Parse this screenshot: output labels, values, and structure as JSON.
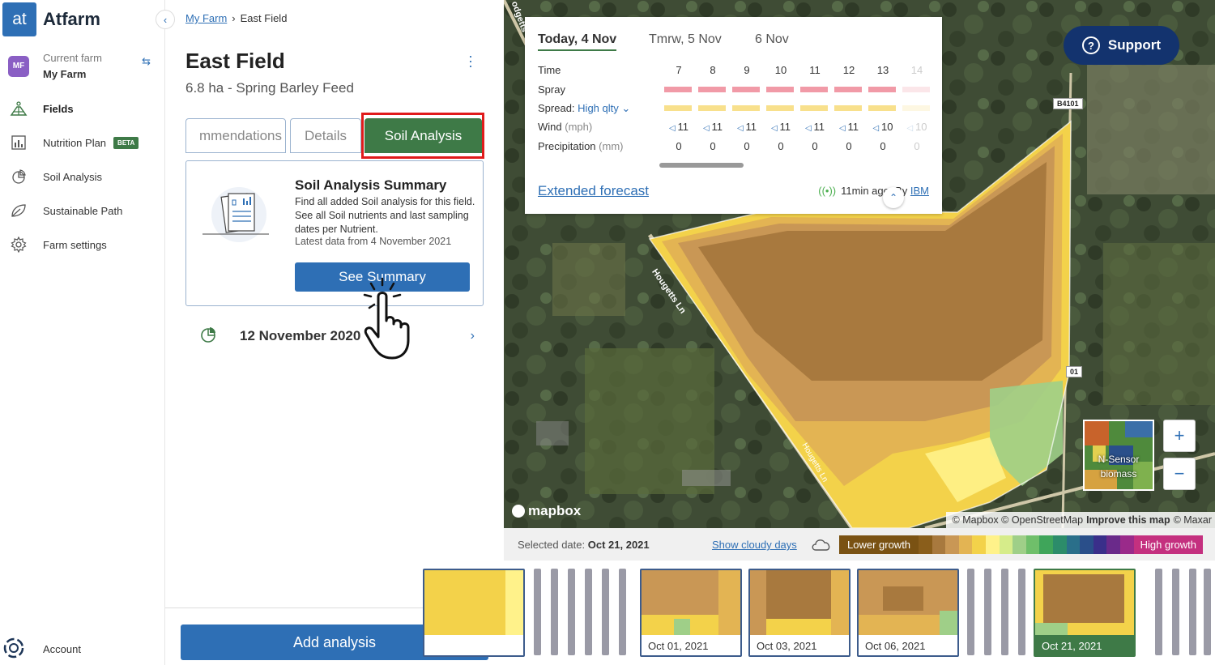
{
  "brand": {
    "logo_mark": "at",
    "name": "Atfarm"
  },
  "farm": {
    "avatar": "MF",
    "caption": "Current farm",
    "name": "My Farm"
  },
  "nav": {
    "fields": "Fields",
    "nutrition_plan": "Nutrition Plan",
    "beta": "BETA",
    "soil_analysis": "Soil Analysis",
    "sustainable_path": "Sustainable Path",
    "farm_settings": "Farm settings",
    "account": "Account"
  },
  "breadcrumb": {
    "parent": "My Farm",
    "separator": "›",
    "current": "East Field"
  },
  "field": {
    "title": "East Field",
    "subtitle": "6.8 ha - Spring Barley Feed"
  },
  "tabs": {
    "recommendations": "mmendations",
    "details": "Details",
    "soil_analysis": "Soil Analysis"
  },
  "summary": {
    "title": "Soil Analysis Summary",
    "description": "Find all added Soil analysis for this field. See all Soil nutrients and last sampling dates per Nutrient.",
    "latest": "Latest data from 4 November 2021",
    "button": "See Summary"
  },
  "analysis_entry": {
    "date": "12 November 2020"
  },
  "add_button": "Add analysis",
  "weather": {
    "tabs": [
      "Today, 4 Nov",
      "Tmrw, 5 Nov",
      "6 Nov"
    ],
    "labels": {
      "time": "Time",
      "spray": "Spray",
      "spread": "Spread:",
      "spread_quality": "High qlty",
      "wind": "Wind",
      "wind_unit": "(mph)",
      "precip": "Precipitation",
      "precip_unit": "(mm)"
    },
    "hours": [
      "7",
      "8",
      "9",
      "10",
      "11",
      "12",
      "13",
      "14"
    ],
    "wind": [
      "11",
      "11",
      "11",
      "11",
      "11",
      "11",
      "10",
      "10"
    ],
    "precip": [
      "0",
      "0",
      "0",
      "0",
      "0",
      "0",
      "0",
      "0"
    ],
    "extended": "Extended forecast",
    "updated": "11min ago. By",
    "provider": "IBM"
  },
  "support": "Support",
  "map": {
    "road_1": "B4101",
    "road_2": "B4101",
    "road_2_visible": "01",
    "lane_1": "Hougetts Ln",
    "lane_2": "Hougetts Ln",
    "left_edge_text": "odgetts",
    "layer_thumb": "N-Sensor biomass",
    "zoom_in": "+",
    "zoom_out": "−",
    "provider_logo": "mapbox",
    "attribution_1": "© Mapbox © OpenStreetMap",
    "attribution_2": "Improve this map",
    "attribution_3": "© Maxar"
  },
  "timeline": {
    "selected_label": "Selected date:",
    "selected_value": "Oct 21, 2021",
    "show_cloudy": "Show cloudy days",
    "legend_low": "Lower growth",
    "legend_high": "High growth",
    "thumbnails": [
      "Oct 01, 2021",
      "Oct 03, 2021",
      "Oct 06, 2021",
      "Oct 21, 2021"
    ]
  },
  "colors": {
    "primary": "#2e6fb5",
    "active_tab": "#3e7a47",
    "highlight": "#e01b1b",
    "support": "#13336e"
  }
}
